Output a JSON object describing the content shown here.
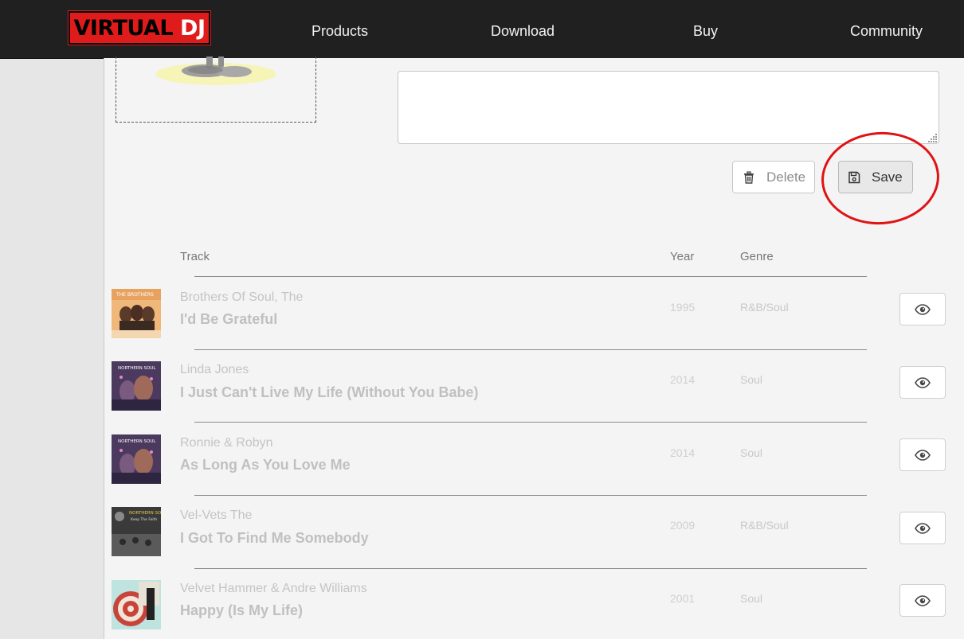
{
  "nav": {
    "logo_text_1": "VIRTUAL",
    "logo_text_2": "DJ",
    "links": [
      "Products",
      "Download",
      "Buy",
      "Community"
    ]
  },
  "editor": {
    "description_value": "",
    "delete_label": "Delete",
    "save_label": "Save"
  },
  "table": {
    "headers": {
      "track": "Track",
      "year": "Year",
      "genre": "Genre"
    },
    "rows": [
      {
        "artist": "Brothers Of Soul, The",
        "title": "I'd Be Grateful",
        "year": "1995",
        "genre": "R&B/Soul"
      },
      {
        "artist": "Linda Jones",
        "title": "I Just Can't Live My Life (Without You Babe)",
        "year": "2014",
        "genre": "Soul"
      },
      {
        "artist": "Ronnie & Robyn",
        "title": "As Long As You Love Me",
        "year": "2014",
        "genre": "Soul"
      },
      {
        "artist": "Vel-Vets The",
        "title": "I Got To Find Me Somebody",
        "year": "2009",
        "genre": "R&B/Soul"
      },
      {
        "artist": "Velvet Hammer & Andre Williams",
        "title": "Happy (Is My Life)",
        "year": "2001",
        "genre": "Soul"
      }
    ]
  },
  "colors": {
    "nav_bg": "#202020",
    "logo_red": "#e01b1b",
    "highlight_red": "#e01313",
    "panel_bg": "#f4f4f4"
  }
}
